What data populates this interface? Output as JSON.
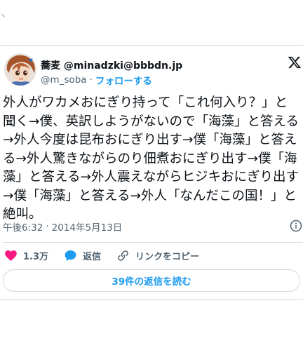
{
  "author": {
    "display_name": "蕎麦 @minadzki@bbbdn.jp",
    "handle": "@m_soba",
    "separator": "·",
    "follow_label": "フォローする"
  },
  "tweet": {
    "text": "外人がワカメおにぎり持って「これ何入り？」と聞く→僕、英訳しようがないので「海藻」と答える→外人今度は昆布おにぎり出す→僕「海藻」と答える→外人驚きながらのり佃煮おにぎり出す→僕「海藻」と答える→外人震えながらヒジキおにぎり出す→僕「海藻」と答える→外人「なんだこの国！」と絶叫。",
    "time": "午後6:32",
    "separator": "·",
    "date": "2014年5月13日"
  },
  "actions": {
    "like_count": "1.3万",
    "reply_label": "返信",
    "copy_link_label": "リンクをコピー"
  },
  "replies_button": {
    "label": "39件の返信を読む"
  },
  "colors": {
    "accent": "#1d9bf0",
    "like": "#f91880",
    "text": "#0f1419",
    "muted": "#536471",
    "border": "#cfd9de"
  },
  "icons": [
    "x-logo-icon",
    "heart-icon",
    "reply-bubble-icon",
    "link-icon",
    "info-icon"
  ]
}
